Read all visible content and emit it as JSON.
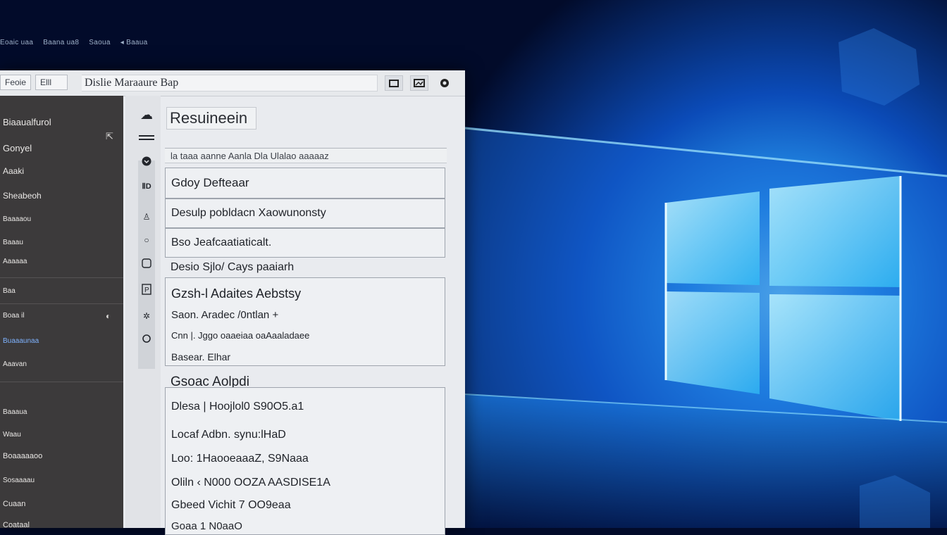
{
  "taskbar": {
    "items": [
      "Eoaic uaa",
      "Baana ua8",
      "Saoua",
      "◂ Baaua"
    ]
  },
  "window": {
    "field1": "Feoie",
    "field2": "Elll",
    "title": "Dislie Maraaure Bap"
  },
  "sidebar": {
    "items": [
      "Biaaualfurol",
      "Gonyel",
      "Aaaki",
      "Sheabeoh",
      "Baaaaou",
      "Baaau",
      "Aaaaaa",
      "Baa",
      "Boaa il",
      "Buaaaunaa",
      "Aaavan",
      "Baaaua",
      "Waau",
      "Boaaaaaoo",
      "Sosaaaau",
      "Cuaan",
      "Coataal"
    ]
  },
  "content": {
    "title": "Resuineein",
    "search_placeholder": "la taaa aanne Aanla Dla Ulalao aaaaaz",
    "rows": [
      "Gdoy Defteaar",
      "Desulp pobldacn Xaowunonsty",
      "Bso Jeafcaatiaticalt.",
      "Desio Sjlo/ Cays paaiarh"
    ],
    "group1": [
      "Gzsh-l Adaites Aebstsy",
      "Saon. Aradec /0ntlan +",
      "Cnn |. Jggo oaaeiaa oaAaaladaee",
      "Basear. Elhar"
    ],
    "section2_title": "Gsoac Aolpdi",
    "group2": [
      "Dlesa | Hoojlol0 S90O5.a1",
      "Locaf Adbn. synu:lHaD",
      "Loo: 1HaooeaaaZ, S9Naaa",
      "Oliln  ‹ N000  OOZA  AASDISE1A",
      "Gbeed Vichit 7 OO9eaa",
      "Goaa  1 N0aaO"
    ]
  },
  "colors": {
    "sidebar_bg": "#3c3a3b",
    "window_bg": "#e9ebef",
    "accent": "#7fb3ff",
    "wallpaper_glow": "#36c4ff"
  }
}
